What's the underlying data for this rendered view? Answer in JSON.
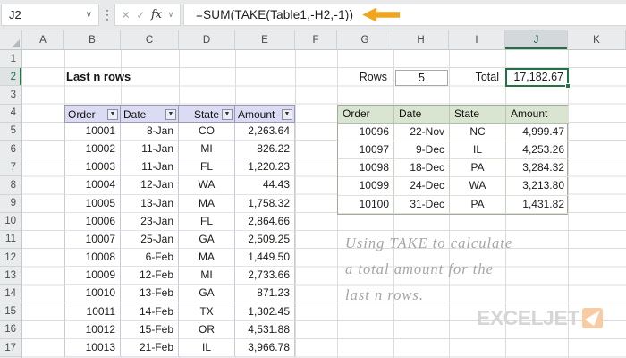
{
  "formula_bar": {
    "name_box": "J2",
    "formula": "=SUM(TAKE(Table1,-H2,-1))"
  },
  "icons": {
    "cancel": "✕",
    "enter": "✓",
    "function": "fx",
    "chevron": "∨",
    "dots": "⋮",
    "filter": "▼"
  },
  "grid": {
    "columns": [
      "A",
      "B",
      "C",
      "D",
      "E",
      "F",
      "G",
      "H",
      "I",
      "J",
      "K"
    ],
    "selected_column": "J",
    "rows": [
      "1",
      "2",
      "3",
      "4",
      "5",
      "6",
      "7",
      "8",
      "9",
      "10",
      "11",
      "12",
      "13",
      "14",
      "15",
      "16",
      "17"
    ],
    "selected_row": "2"
  },
  "worksheet": {
    "title_cell": "Last n rows",
    "rows_label": "Rows",
    "rows_value": "5",
    "total_label": "Total",
    "total_value": "17,182.67"
  },
  "left_table": {
    "headers": [
      "Order",
      "Date",
      "State",
      "Amount"
    ],
    "rows": [
      [
        "10001",
        "8-Jan",
        "CO",
        "2,263.64"
      ],
      [
        "10002",
        "11-Jan",
        "MI",
        "826.22"
      ],
      [
        "10003",
        "11-Jan",
        "FL",
        "1,220.23"
      ],
      [
        "10004",
        "12-Jan",
        "WA",
        "44.43"
      ],
      [
        "10005",
        "13-Jan",
        "MA",
        "1,758.32"
      ],
      [
        "10006",
        "23-Jan",
        "FL",
        "2,864.66"
      ],
      [
        "10007",
        "25-Jan",
        "GA",
        "2,509.25"
      ],
      [
        "10008",
        "6-Feb",
        "MA",
        "1,449.50"
      ],
      [
        "10009",
        "12-Feb",
        "MI",
        "2,733.66"
      ],
      [
        "10010",
        "13-Feb",
        "GA",
        "871.23"
      ],
      [
        "10011",
        "14-Feb",
        "TX",
        "1,302.45"
      ],
      [
        "10012",
        "15-Feb",
        "OR",
        "4,531.88"
      ],
      [
        "10013",
        "21-Feb",
        "IL",
        "3,966.78"
      ]
    ]
  },
  "right_table": {
    "headers": [
      "Order",
      "Date",
      "State",
      "Amount"
    ],
    "rows": [
      [
        "10096",
        "22-Nov",
        "NC",
        "4,999.47"
      ],
      [
        "10097",
        "9-Dec",
        "IL",
        "4,253.26"
      ],
      [
        "10098",
        "18-Dec",
        "PA",
        "3,284.32"
      ],
      [
        "10099",
        "24-Dec",
        "WA",
        "3,213.80"
      ],
      [
        "10100",
        "31-Dec",
        "PA",
        "1,431.82"
      ]
    ]
  },
  "annotation": {
    "line1": "Using TAKE to calculate",
    "line2": "a total amount for the",
    "line3": "last n rows."
  },
  "logo": {
    "text": "EXCELJET"
  },
  "colors": {
    "accent_green": "#217346",
    "arrow_orange": "#efa51f",
    "left_table_header_fill": "#dbdbf3",
    "right_table_header_fill": "#d9e5d1",
    "logo_gray": "#d6d6d6",
    "logo_orange": "#f8cba2"
  }
}
